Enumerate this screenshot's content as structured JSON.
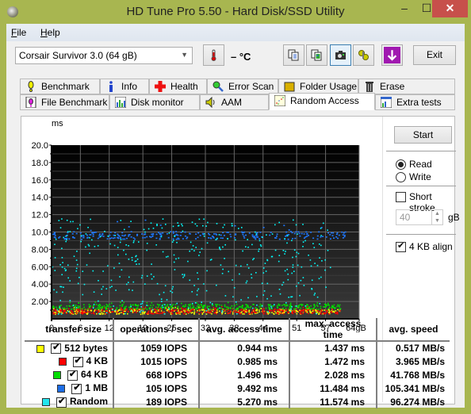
{
  "window": {
    "title": "HD Tune Pro 5.50 - Hard Disk/SSD Utility",
    "minimize": "–",
    "maximize": "☐",
    "close": "✕"
  },
  "menu": {
    "items": [
      {
        "label": "File",
        "accel": "F",
        "rest": "ile"
      },
      {
        "label": "Help",
        "accel": "H",
        "rest": "elp"
      }
    ]
  },
  "toolbar": {
    "drive": "Corsair Survivor 3.0 (64 gB)",
    "temperature": "– °C",
    "exit_label": "Exit",
    "icons": [
      "copy-text-icon",
      "copy-screenshot-icon",
      "camera-icon",
      "options-icon",
      "save-icon"
    ]
  },
  "tabs": {
    "row1": [
      {
        "label": "Benchmark",
        "icon": "benchmark-icon"
      },
      {
        "label": "Info",
        "icon": "info-icon"
      },
      {
        "label": "Health",
        "icon": "health-icon"
      },
      {
        "label": "Error Scan",
        "icon": "error-scan-icon"
      },
      {
        "label": "Folder Usage",
        "icon": "folder-icon"
      },
      {
        "label": "Erase",
        "icon": "trash-icon"
      }
    ],
    "row2": [
      {
        "label": "File Benchmark",
        "icon": "file-benchmark-icon"
      },
      {
        "label": "Disk monitor",
        "icon": "disk-monitor-icon"
      },
      {
        "label": "AAM",
        "icon": "speaker-icon"
      },
      {
        "label": "Random Access",
        "icon": "random-access-icon",
        "active": true
      },
      {
        "label": "Extra tests",
        "icon": "extra-tests-icon"
      }
    ]
  },
  "side": {
    "start_label": "Start",
    "read_label": "Read",
    "write_label": "Write",
    "mode": "Read",
    "short_stroke_label": "Short stroke",
    "short_stroke_checked": false,
    "short_stroke_value": "40",
    "short_stroke_unit": "gB",
    "align_label": "4 KB align",
    "align_checked": true
  },
  "chart_data": {
    "type": "scatter",
    "title": "",
    "ylabel": "ms",
    "xlabel": "",
    "ylim": [
      0,
      20
    ],
    "xlim": [
      0,
      64
    ],
    "y_ticks": [
      "20.0",
      "18.0",
      "16.0",
      "14.0",
      "12.0",
      "10.0",
      "8.00",
      "6.00",
      "4.00",
      "2.00"
    ],
    "y_tick_values": [
      20,
      18,
      16,
      14,
      12,
      10,
      8,
      6,
      4,
      2
    ],
    "x_ticks": [
      "0",
      "6",
      "12",
      "19",
      "25",
      "32",
      "38",
      "44",
      "51",
      "57",
      "64gB"
    ],
    "x_tick_values": [
      0,
      6,
      12,
      19,
      25,
      32,
      38,
      44,
      51,
      57,
      64
    ],
    "grid": true,
    "series": [
      {
        "name": "512 bytes",
        "color": "#ffff00",
        "mean_ms": 0.944,
        "max_ms": 1.437,
        "x_max": 60
      },
      {
        "name": "4 KB",
        "color": "#ff0000",
        "mean_ms": 0.985,
        "max_ms": 1.472,
        "x_max": 60
      },
      {
        "name": "64 KB",
        "color": "#00e000",
        "mean_ms": 1.496,
        "max_ms": 2.028,
        "x_max": 60
      },
      {
        "name": "1 MB",
        "color": "#1e78ff",
        "mean_ms": 9.492,
        "max_ms": 11.484,
        "x_max": 61
      },
      {
        "name": "Random",
        "color": "#00ffff",
        "mean_ms": 5.27,
        "max_ms": 11.574,
        "x_max": 58
      }
    ]
  },
  "results": {
    "headers": [
      "transfer size",
      "operations / sec",
      "avg. access time",
      "max. access time",
      "avg. speed"
    ],
    "rows": [
      {
        "color": "#ffff00",
        "checked": true,
        "size": "512 bytes",
        "ops": "1059 IOPS",
        "avg": "0.944 ms",
        "max": "1.437 ms",
        "speed": "0.517 MB/s"
      },
      {
        "color": "#ff0000",
        "checked": true,
        "size": "4 KB",
        "ops": "1015 IOPS",
        "avg": "0.985 ms",
        "max": "1.472 ms",
        "speed": "3.965 MB/s"
      },
      {
        "color": "#00dd00",
        "checked": true,
        "size": "64 KB",
        "ops": "668 IOPS",
        "avg": "1.496 ms",
        "max": "2.028 ms",
        "speed": "41.768 MB/s"
      },
      {
        "color": "#1e6ee6",
        "checked": true,
        "size": "1 MB",
        "ops": "105 IOPS",
        "avg": "9.492 ms",
        "max": "11.484 ms",
        "speed": "105.341 MB/s"
      },
      {
        "color": "#22e6f0",
        "checked": true,
        "size": "Random",
        "ops": "189 IOPS",
        "avg": "5.270 ms",
        "max": "11.574 ms",
        "speed": "96.274 MB/s"
      }
    ]
  }
}
